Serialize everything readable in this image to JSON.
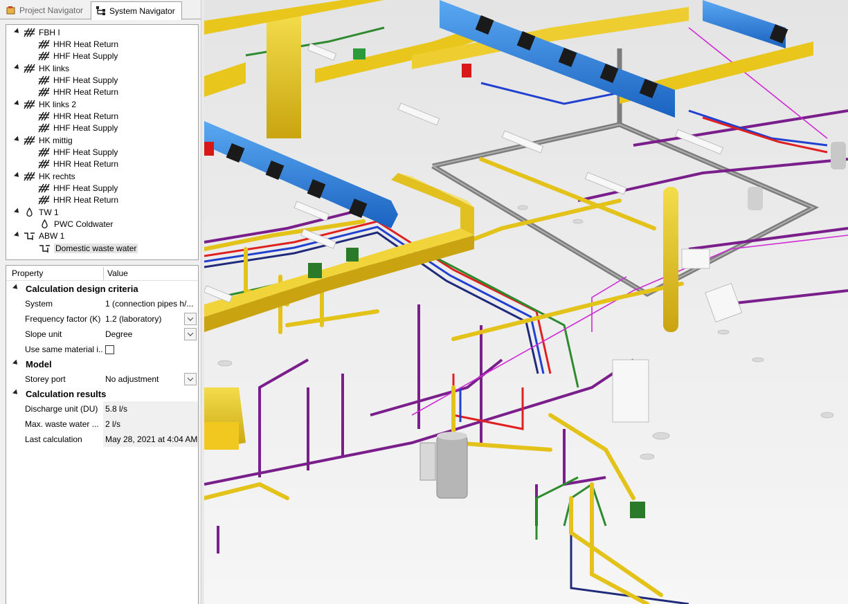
{
  "tabs": {
    "project_navigator": "Project Navigator",
    "system_navigator": "System Navigator"
  },
  "tree": {
    "items": [
      {
        "label": "FBH I",
        "level": 0,
        "icon": "heating-system-icon"
      },
      {
        "label": "HHR Heat Return",
        "level": 1,
        "icon": "heating-system-icon"
      },
      {
        "label": "HHF Heat Supply",
        "level": 1,
        "icon": "heating-system-icon"
      },
      {
        "label": "HK links",
        "level": 0,
        "icon": "heating-system-icon"
      },
      {
        "label": "HHF Heat Supply",
        "level": 1,
        "icon": "heating-system-icon"
      },
      {
        "label": "HHR Heat Return",
        "level": 1,
        "icon": "heating-system-icon"
      },
      {
        "label": "HK links 2",
        "level": 0,
        "icon": "heating-system-icon"
      },
      {
        "label": "HHR Heat Return",
        "level": 1,
        "icon": "heating-system-icon"
      },
      {
        "label": "HHF Heat Supply",
        "level": 1,
        "icon": "heating-system-icon"
      },
      {
        "label": "HK mittig",
        "level": 0,
        "icon": "heating-system-icon"
      },
      {
        "label": "HHF Heat Supply",
        "level": 1,
        "icon": "heating-system-icon"
      },
      {
        "label": "HHR Heat Return",
        "level": 1,
        "icon": "heating-system-icon"
      },
      {
        "label": "HK rechts",
        "level": 0,
        "icon": "heating-system-icon"
      },
      {
        "label": "HHF Heat Supply",
        "level": 1,
        "icon": "heating-system-icon"
      },
      {
        "label": "HHR Heat Return",
        "level": 1,
        "icon": "heating-system-icon"
      },
      {
        "label": "TW 1",
        "level": 0,
        "icon": "water-drop-icon"
      },
      {
        "label": "PWC Coldwater",
        "level": 1,
        "icon": "water-drop-icon"
      },
      {
        "label": "ABW 1",
        "level": 0,
        "icon": "waste-water-icon"
      },
      {
        "label": "Domestic waste water",
        "level": 1,
        "icon": "waste-water-icon",
        "selected": true
      }
    ]
  },
  "props": {
    "header_property": "Property",
    "header_value": "Value",
    "cat_calc_criteria": "Calculation design criteria",
    "system_key": "System",
    "system_val": "1 (connection pipes h/...",
    "freq_key": "Frequency factor (K)",
    "freq_val": "1.2 (laboratory)",
    "slope_key": "Slope unit",
    "slope_val": "Degree",
    "same_mat_key": "Use same material i...",
    "cat_model": "Model",
    "storey_key": "Storey port",
    "storey_val": "No adjustment",
    "cat_results": "Calculation results",
    "du_key": "Discharge unit (DU)",
    "du_val": "5.8 l/s",
    "maxww_key": "Max. waste water ...",
    "maxww_val": "2 l/s",
    "lastcalc_key": "Last calculation",
    "lastcalc_val": "May 28, 2021 at 4:04 AM"
  },
  "viewport": {
    "content": "3d-pipe-model",
    "colors": {
      "duct_yellow": "#e8c61c",
      "duct_blue": "#2f86e0",
      "pipe_purple": "#7a1e8c",
      "pipe_red": "#e02020",
      "pipe_green": "#2e8a2e",
      "pipe_magenta": "#d02ad6",
      "pipe_navy": "#202a7a",
      "tray_gray": "#6a6a6a"
    }
  }
}
